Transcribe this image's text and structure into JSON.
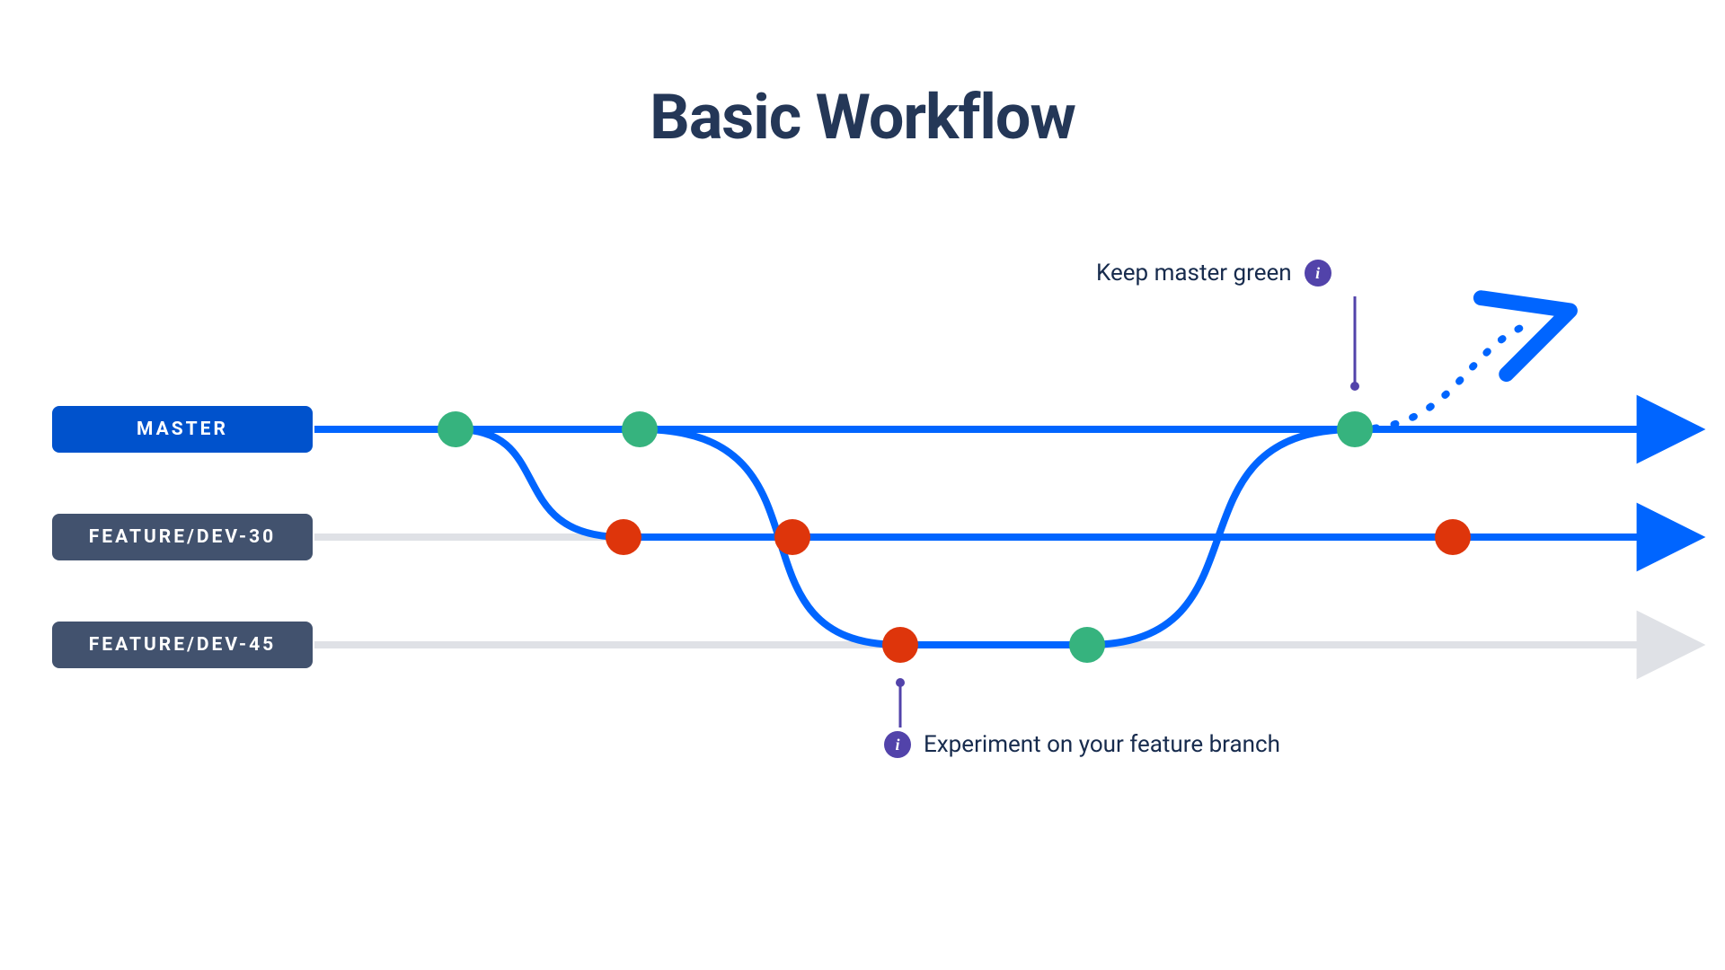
{
  "title": "Basic Workflow",
  "branches": {
    "master": "MASTER",
    "feature30": "FEATURE/DEV-30",
    "feature45": "FEATURE/DEV-45"
  },
  "annotations": {
    "keep_master": "Keep master green",
    "experiment": "Experiment on your feature branch"
  },
  "colors": {
    "blue": "#0065ff",
    "green": "#36b37e",
    "red": "#de350b",
    "purple": "#5243aa",
    "grey": "#dfe1e6",
    "title": "#243757",
    "text": "#172b4d"
  },
  "info_glyph": "i"
}
